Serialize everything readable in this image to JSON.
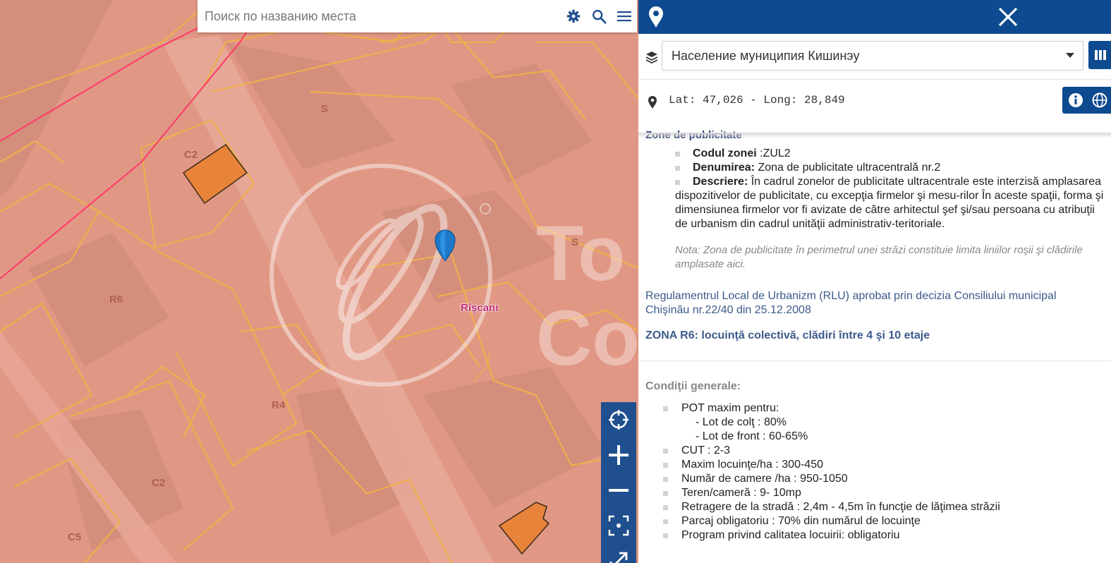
{
  "search": {
    "placeholder": "Поиск по названию места"
  },
  "map": {
    "zone_labels": [
      "S",
      "C2",
      "S",
      "R6",
      "R4",
      "C2",
      "C5"
    ],
    "district_label": "Rîşcani",
    "watermark_text": [
      "To",
      "Co"
    ]
  },
  "map_controls": [
    "locate-icon",
    "zoom-in-icon",
    "zoom-out-icon",
    "fit-extent-icon",
    "fullscreen-icon"
  ],
  "panel": {
    "header_icons": [
      "map-pin-icon",
      "close-icon"
    ],
    "layer": {
      "selected": "Население муниципия Кишинэу"
    },
    "coords": "Lat: 47,026 - Long: 28,849",
    "publicity": {
      "title": "Zone de publicitate",
      "items": [
        {
          "key": "Codul zonei",
          "value": " :ZUL2"
        },
        {
          "key": "Denumirea:",
          "value": " Zona de publicitate ultracentrală nr.2"
        },
        {
          "key": "Descriere:",
          "value": " În cadrul zonelor de publicitate ultracentrale este interzisă amplasarea dispozitivelor de publicitate, cu excepţia firmelor şi mesu-rilor În aceste spaţii, forma şi dimensiunea firmelor vor fi avizate de către arhitectul şef şi/sau persoana cu atribuţii de urbanism din cadrul unităţii administrativ-teritoriale."
        }
      ],
      "note": "Nota: Zona de publicitate în perimetrul unei străzi constituie limita liniilor roşii şi clădirile amplasate aici."
    },
    "rlu": "Regulamentrul Local de Urbanizm (RLU) aprobat prin decizia Consiliului municipal Chişinău nr.22/40 din 25.12.2008",
    "zone_r6": "ZONA R6: locuinţă colectivă, clădiri între 4 şi 10 etaje",
    "conditions": {
      "title": "Condiţii generale:",
      "pot_label": "POT maxim pentru:",
      "pot_sub": [
        "- Lot de colţ : 80%",
        "- Lot de front : 60-65%"
      ],
      "items": [
        "CUT : 2-3",
        "Maxim locuinţe/ha : 300-450",
        "Număr de camere /ha : 950-1050",
        "Teren/cameră : 9- 10mp",
        "Retragere de la stradă : 2,4m - 4,5m în funcţie de lăţimea străzii",
        "Parcaj obligatoriu : 70% din numărul de locuinţe",
        "Program privind calitatea locuirii: obligatoriu"
      ]
    }
  },
  "colors": {
    "primary": "#0d4a8f",
    "map_controls": "#1f4f8f",
    "zone_overlay": "#e39a86",
    "parcel_outline": "#f0b048",
    "highlight_parcel": "#e8833a",
    "red_line": "#ff3a6a"
  }
}
